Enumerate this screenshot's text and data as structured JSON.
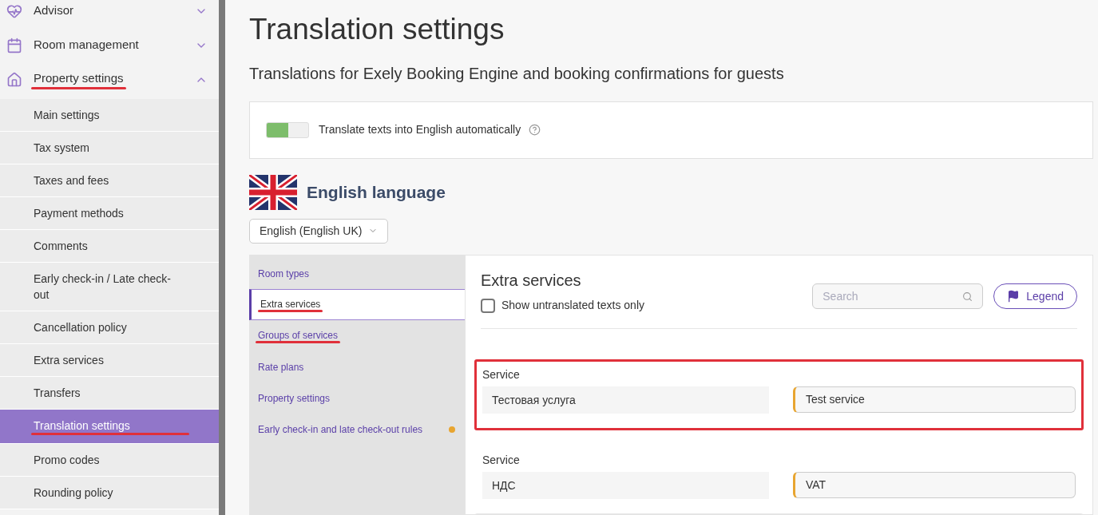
{
  "sidebar": {
    "groups": [
      {
        "label": "Advisor",
        "expanded": false,
        "underlined": false
      },
      {
        "label": "Room management",
        "expanded": false,
        "underlined": false
      },
      {
        "label": "Property settings",
        "expanded": true,
        "underlined": true
      }
    ],
    "items": [
      {
        "label": "Main settings",
        "selected": false,
        "underlined": false
      },
      {
        "label": "Tax system",
        "selected": false,
        "underlined": false
      },
      {
        "label": "Taxes and fees",
        "selected": false,
        "underlined": false
      },
      {
        "label": "Payment methods",
        "selected": false,
        "underlined": false
      },
      {
        "label": "Comments",
        "selected": false,
        "underlined": false
      },
      {
        "label": "Early check-in / Late check-out",
        "selected": false,
        "underlined": false
      },
      {
        "label": "Cancellation policy",
        "selected": false,
        "underlined": false
      },
      {
        "label": "Extra services",
        "selected": false,
        "underlined": false
      },
      {
        "label": "Transfers",
        "selected": false,
        "underlined": false
      },
      {
        "label": "Translation settings",
        "selected": true,
        "underlined": true
      },
      {
        "label": "Promo codes",
        "selected": false,
        "underlined": false
      },
      {
        "label": "Rounding policy",
        "selected": false,
        "underlined": false
      }
    ]
  },
  "page": {
    "title": "Translation settings",
    "subtitle": "Translations for Exely Booking Engine and booking confirmations for guests"
  },
  "auto_translate": {
    "label": "Translate texts into English automatically",
    "on": true
  },
  "language": {
    "title": "English language",
    "select": "English (English UK)"
  },
  "sections": [
    {
      "label": "Room types",
      "selected": false,
      "underlined": false,
      "dot": false
    },
    {
      "label": "Extra services",
      "selected": true,
      "underlined": true,
      "dot": false
    },
    {
      "label": "Groups of services",
      "selected": false,
      "underlined": true,
      "dot": false
    },
    {
      "label": "Rate plans",
      "selected": false,
      "underlined": false,
      "dot": false
    },
    {
      "label": "Property settings",
      "selected": false,
      "underlined": false,
      "dot": false
    },
    {
      "label": "Early check-in and late check-out rules",
      "selected": false,
      "underlined": false,
      "dot": true
    }
  ],
  "panel": {
    "title": "Extra services",
    "untranslated_only": {
      "label": "Show untranslated texts only",
      "checked": false
    },
    "search": {
      "placeholder": "Search"
    },
    "legend": "Legend",
    "entries": [
      {
        "label": "Service",
        "source": "Тестовая услуга",
        "translation": "Test service",
        "outlined": true
      },
      {
        "label": "Service",
        "source": "НДС",
        "translation": "VAT",
        "outlined": false
      }
    ]
  }
}
